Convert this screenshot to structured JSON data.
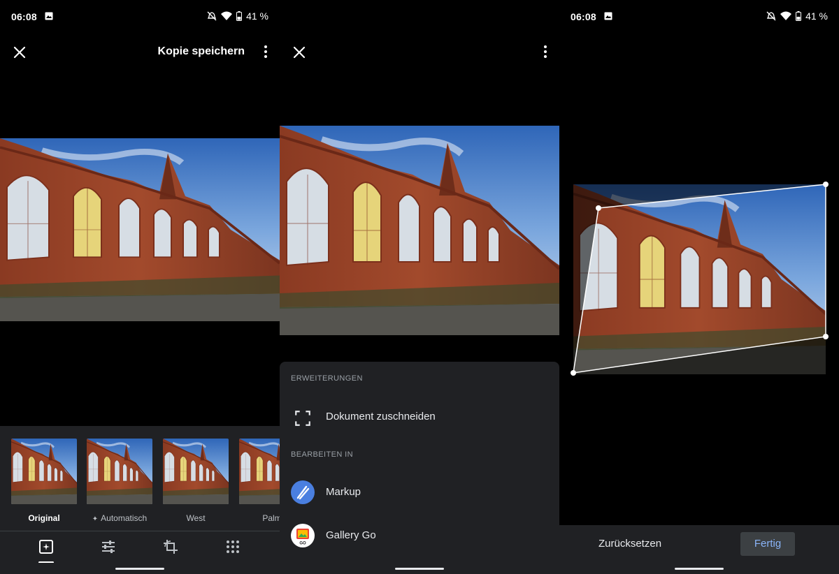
{
  "status": {
    "time": "06:08",
    "battery": "41 %"
  },
  "editor": {
    "save_copy": "Kopie speichern",
    "filters": [
      {
        "label": "Original",
        "selected": true
      },
      {
        "label": "Automatisch",
        "selected": false
      },
      {
        "label": "West",
        "selected": false
      },
      {
        "label": "Palm",
        "selected": false
      }
    ],
    "tabs": [
      "filters-icon",
      "adjust-icon",
      "crop-rotate-icon",
      "more-tools-icon"
    ]
  },
  "menu": {
    "section_extensions": "ERWEITERUNGEN",
    "crop_document": "Dokument zuschneiden",
    "section_edit_in": "BEARBEITEN IN",
    "apps": [
      {
        "label": "Markup"
      },
      {
        "label": "Gallery Go",
        "badge": "GO"
      }
    ]
  },
  "crop": {
    "reset": "Zurücksetzen",
    "done": "Fertig"
  },
  "colors": {
    "sheet": "#202124",
    "accent": "#8ab4f8"
  }
}
